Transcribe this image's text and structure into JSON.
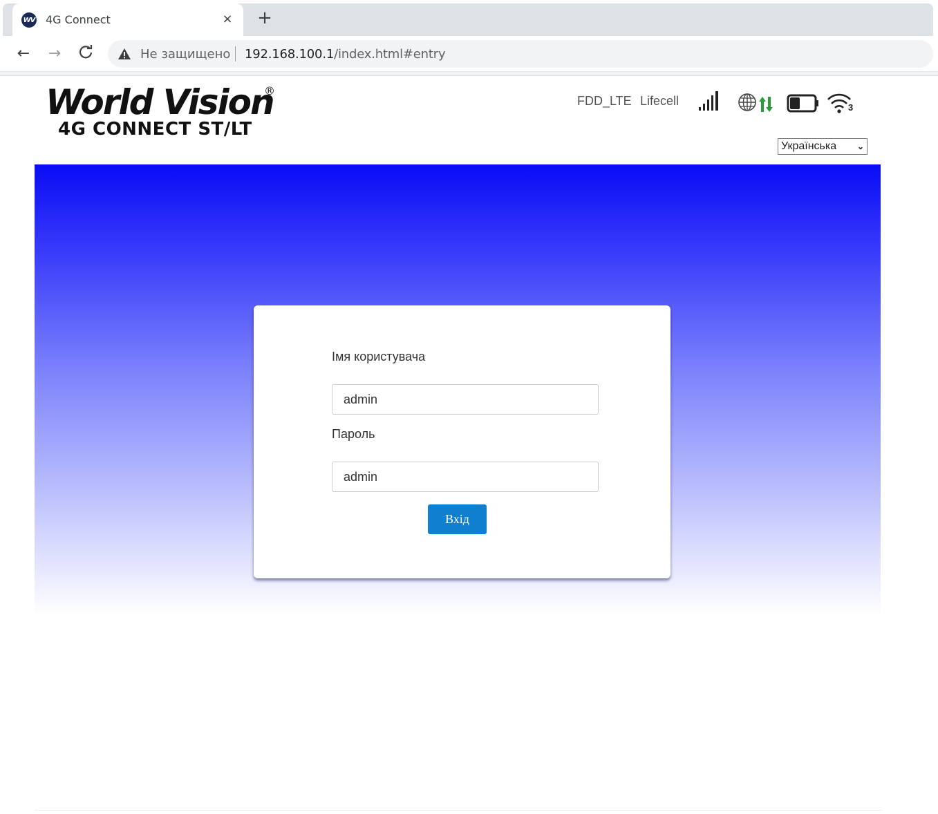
{
  "browser": {
    "tab": {
      "title": "4G Connect",
      "favicon_text": "WV",
      "close_glyph": "×"
    },
    "new_tab_glyph": "+",
    "nav": {
      "back_glyph": "←",
      "forward_glyph": "→",
      "reload_glyph": "C"
    },
    "address_bar": {
      "security_text": "Не защищено",
      "url_host": "192.168.100.1",
      "url_path": "/index.html#entry"
    }
  },
  "header": {
    "logo_title": "World Vision",
    "logo_registered": "®",
    "logo_subtitle": "4G CONNECT ST/LT",
    "status": {
      "network_type": "FDD_LTE",
      "operator": "Lifecell",
      "icons": [
        "signal-strength-icon",
        "globe-icon",
        "data-transfer-icon",
        "battery-icon",
        "wifi-icon"
      ],
      "wifi_clients": "3"
    },
    "language": "Українська"
  },
  "login": {
    "username_label": "Імя користувача",
    "username_value": "admin",
    "password_label": "Пароль",
    "password_value": "admin",
    "submit_label": "Вхід"
  },
  "colors": {
    "gradient_top": "#0a0cf5",
    "gradient_bottom": "#ffffff",
    "button": "#0f7fd0",
    "data_arrows": "#2a9d3a"
  }
}
